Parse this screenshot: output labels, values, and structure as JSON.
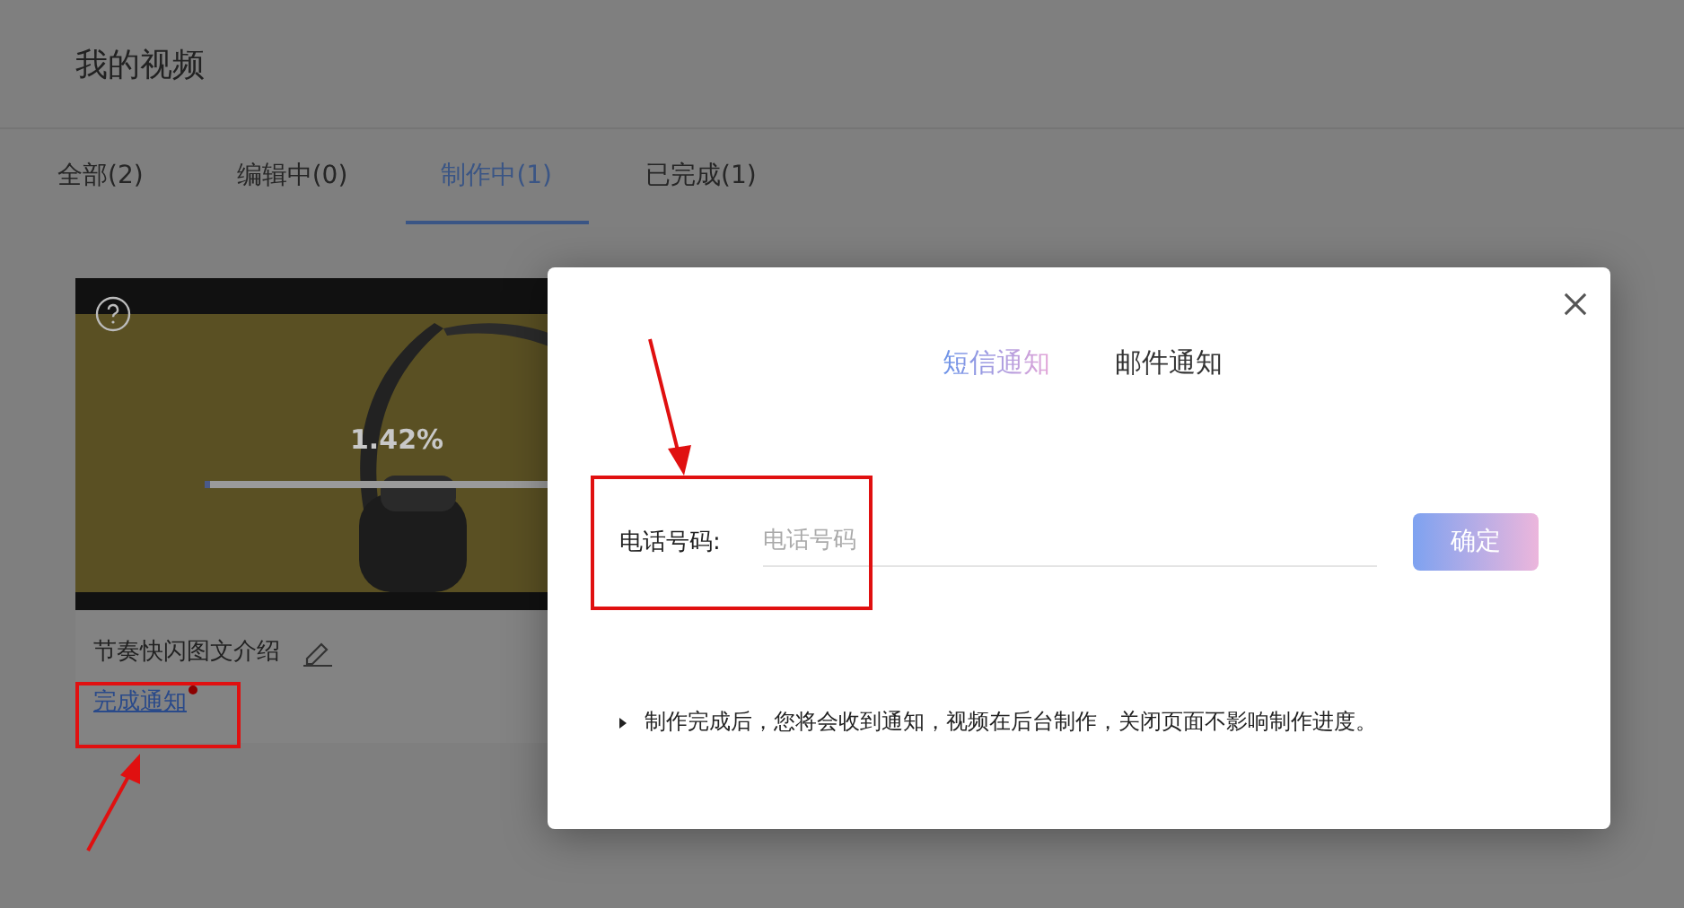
{
  "page": {
    "title": "我的视频"
  },
  "tabs": [
    {
      "label": "全部(2)",
      "selected": false
    },
    {
      "label": "编辑中(0)",
      "selected": false
    },
    {
      "label": "制作中(1)",
      "selected": true
    },
    {
      "label": "已完成(1)",
      "selected": false
    }
  ],
  "video_card": {
    "progress_text": "1.42%",
    "level": 0.0142,
    "title": "节奏快闪图文介绍",
    "notify_link": "完成通知",
    "unread": true
  },
  "dialog": {
    "tabs": [
      {
        "label": "短信通知",
        "selected": true
      },
      {
        "label": "邮件通知",
        "selected": false
      }
    ],
    "field_label": "电话号码:",
    "placeholder": "电话号码",
    "confirm": "确定",
    "note": "制作完成后，您将会收到通知，视频在后台制作，关闭页面不影响制作进度。"
  }
}
